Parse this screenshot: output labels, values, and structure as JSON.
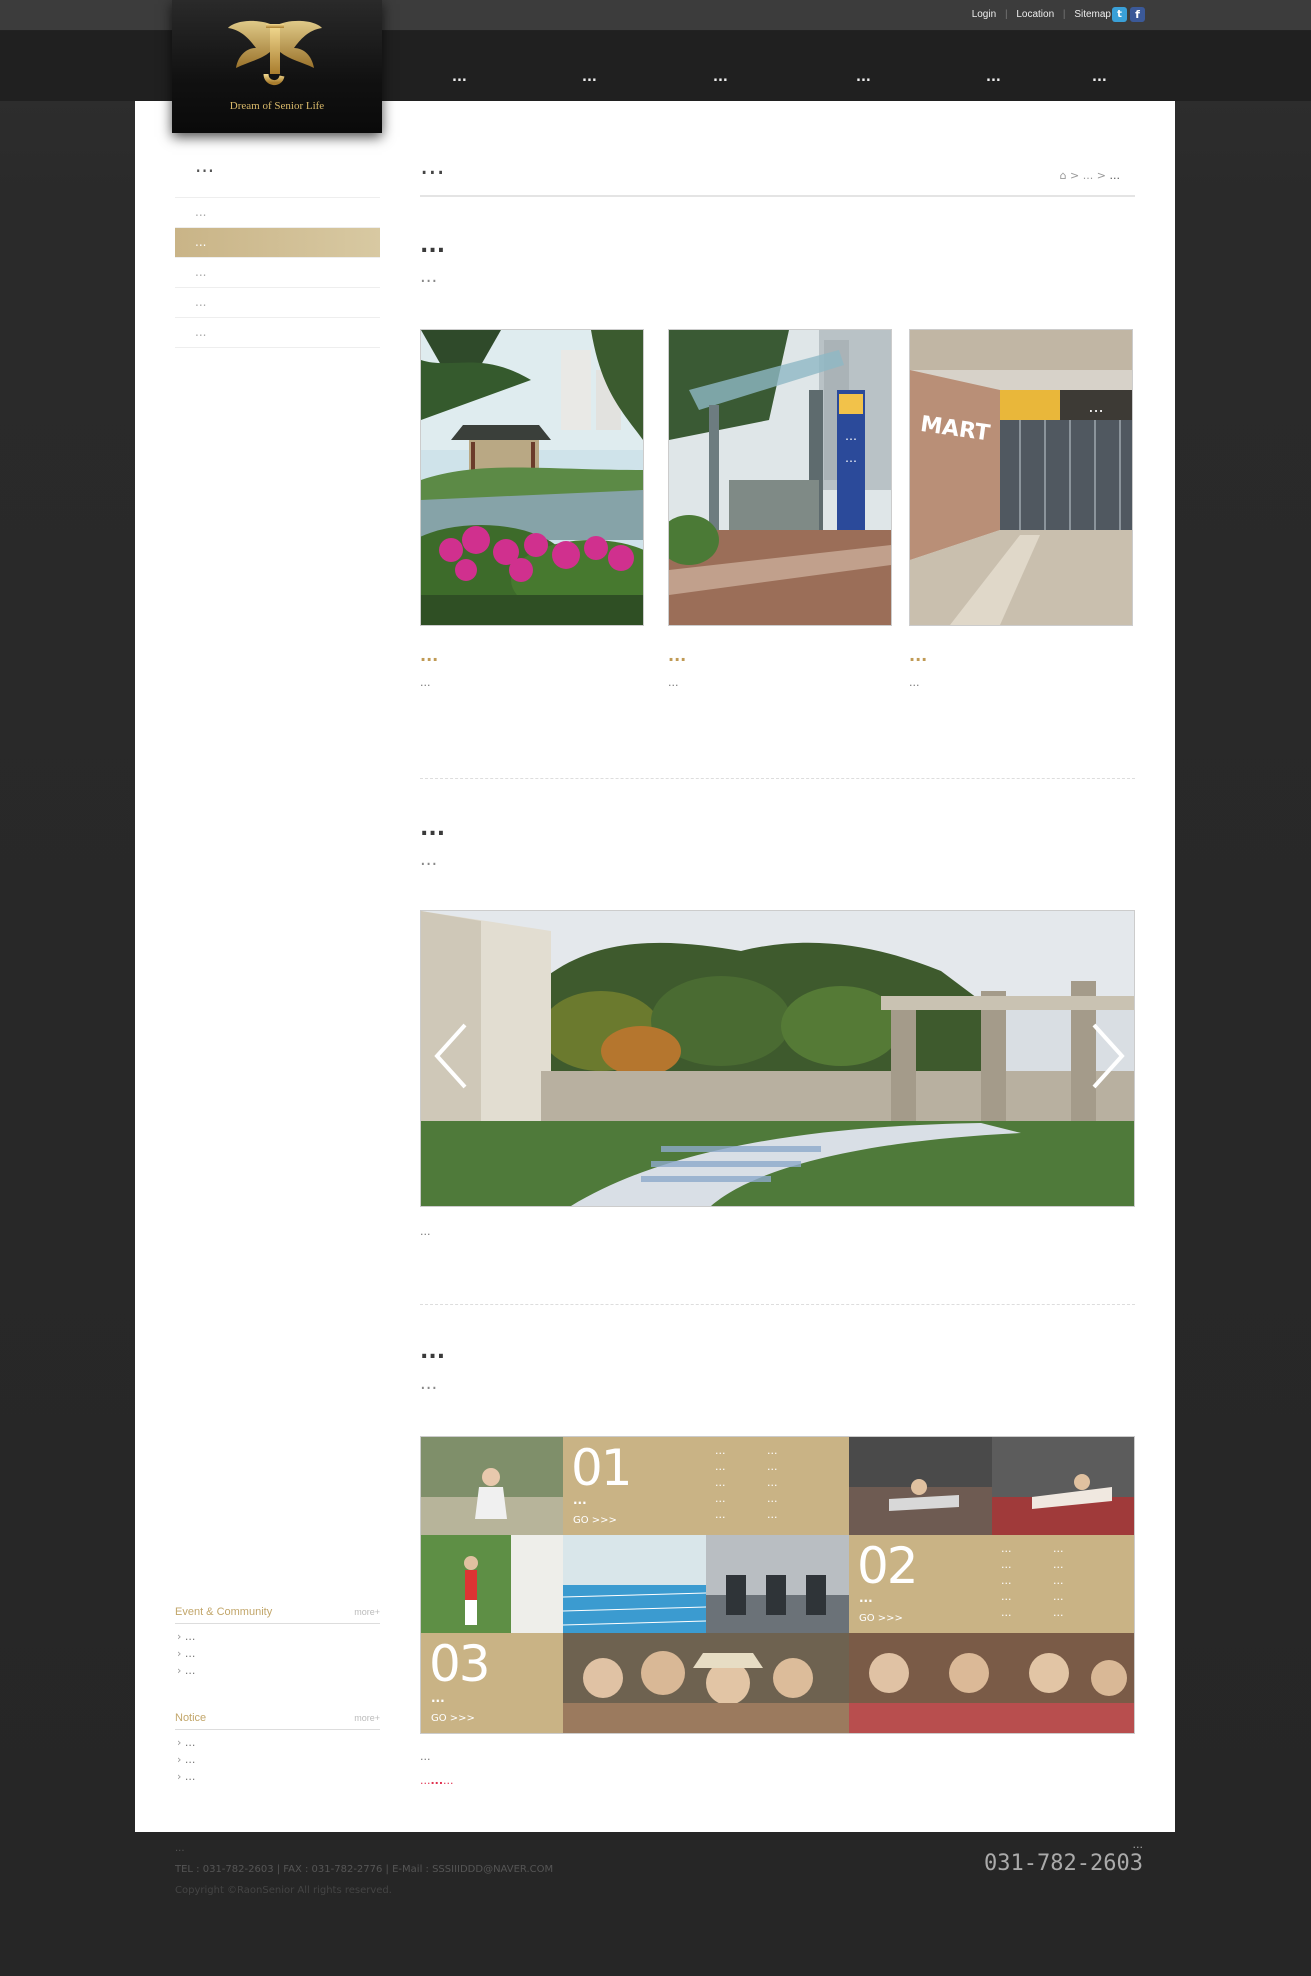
{
  "utility": {
    "login": "Login",
    "location": "Location",
    "sitemap": "Sitemap"
  },
  "logo": {
    "tagline": "Dream of Senior Life"
  },
  "nav": [
    "...",
    "...",
    "...",
    "...",
    "...",
    "..."
  ],
  "lnb": {
    "title": "...",
    "items": [
      "...",
      "...",
      "...",
      "...",
      "..."
    ]
  },
  "event": {
    "title": "Event & Community",
    "more": "more+",
    "items": [
      "...",
      "...",
      "..."
    ]
  },
  "notice": {
    "title": "Notice",
    "more": "more+",
    "items": [
      "...",
      "...",
      "..."
    ]
  },
  "page": {
    "title": "...",
    "breadcrumb_home": "⌂",
    "breadcrumb_1": "...",
    "breadcrumb_2": "..."
  },
  "section1": {
    "heading": "...",
    "sub": "...",
    "cards": [
      {
        "title": "...",
        "desc": "..."
      },
      {
        "title": "...",
        "desc": "..."
      },
      {
        "title": "...",
        "desc": "..."
      }
    ]
  },
  "section2": {
    "heading": "...",
    "sub": "...",
    "desc": "..."
  },
  "section3": {
    "heading": "...",
    "sub": "...",
    "tile1": {
      "num": "01",
      "name": "...",
      "go": "GO >>>",
      "list": [
        "...",
        "...",
        "...",
        "...",
        "...",
        "...",
        "...",
        "...",
        "...",
        "..."
      ]
    },
    "tile2": {
      "num": "02",
      "name": "...",
      "go": "GO >>>",
      "list": [
        "...",
        "...",
        "...",
        "...",
        "...",
        "...",
        "...",
        "...",
        "...",
        "..."
      ]
    },
    "tile3": {
      "num": "03",
      "name": "...",
      "go": "GO >>>"
    },
    "desc": "...",
    "note_prefix": "...",
    "note_links": "...",
    "note_suffix": "..."
  },
  "footer": {
    "line1": "...",
    "line2": "TEL : 031-782-2603  |  FAX : 031-782-2776  |  E-Mail : SSSIIIDDD@NAVER.COM",
    "copyright": "Copyright ©RaonSenior All rights reserved.",
    "hours": "...",
    "phone": "031-782-2603"
  },
  "colors": {
    "accent": "#c09a55",
    "gold_tile": "#c9b385",
    "note_red": "#e0314f"
  }
}
